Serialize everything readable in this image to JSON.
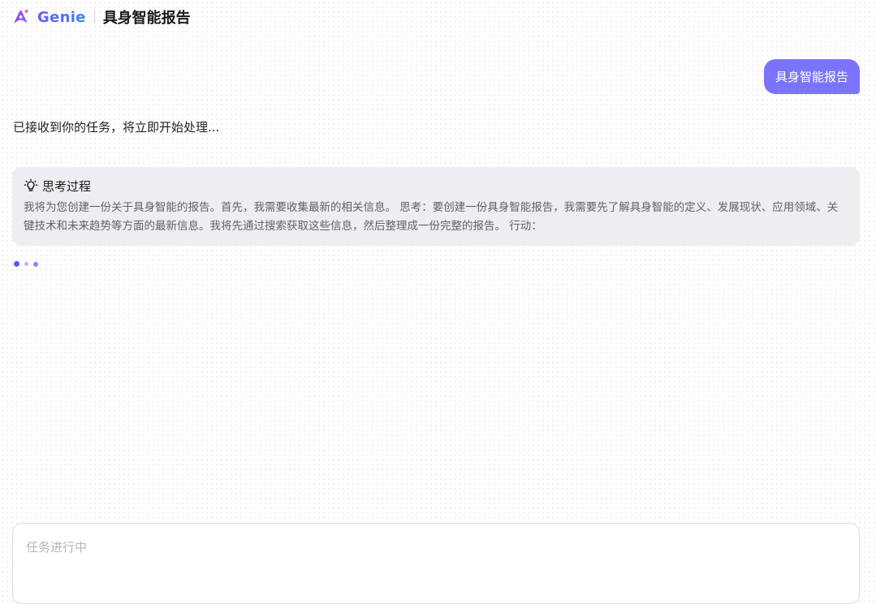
{
  "header": {
    "brand": "Genie",
    "title": "具身智能报告",
    "logo_icon": "genie-logo-icon"
  },
  "conversation": {
    "user_message": "具身智能报告",
    "ack_message": "已接收到你的任务，将立即开始处理...",
    "thinking": {
      "icon": "lightbulb-icon",
      "title": "思考过程",
      "content": "我将为您创建一份关于具身智能的报告。首先，我需要收集最新的相关信息。 思考：要创建一份具身智能报告，我需要先了解具身智能的定义、发展现状、应用领域、关键技术和未来趋势等方面的最新信息。我将先通过搜索获取这些信息，然后整理成一份完整的报告。 行动："
    },
    "loading_indicator": "loading-dots"
  },
  "composer": {
    "placeholder": "任务进行中",
    "value": ""
  },
  "colors": {
    "accent": "#7b74fb",
    "brand_gradient_start": "#6b5cf6",
    "brand_gradient_end": "#3b82f6",
    "thinking_bg": "#eceef2"
  }
}
